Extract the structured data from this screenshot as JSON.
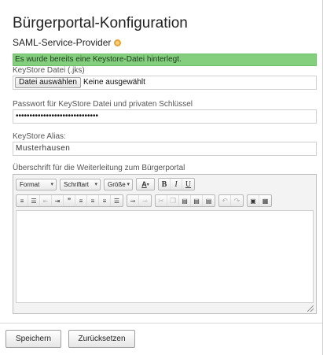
{
  "heading": "Bürgerportal-Konfiguration",
  "section": {
    "title": "SAML-Service-Provider",
    "icon": "info-icon"
  },
  "notice": "Es wurde bereits eine Keystore-Datei hinterlegt.",
  "keystore_file": {
    "label": "KeyStore Datei (.jks)",
    "button_label": "Datei auswählen",
    "status": "Keine ausgewählt"
  },
  "password": {
    "label": "Passwort für KeyStore Datei und privaten Schlüssel",
    "value": "••••••••••••••••••••••••••••••"
  },
  "alias": {
    "label": "KeyStore Alias:",
    "value": "Musterhausen"
  },
  "editor": {
    "label": "Überschrift für die Weiterleitung zum Bürgerportal",
    "combos": {
      "format": "Format",
      "font": "Schriftart",
      "size": "Größe"
    },
    "text_color_label": "A",
    "bold": "B",
    "italic": "I",
    "underline": "U",
    "list_numbered": "⒈",
    "list_bullet": "•",
    "blockquote": "❞"
  },
  "buttons": {
    "save": "Speichern",
    "reset": "Zurücksetzen"
  },
  "colors": {
    "notice_bg": "#84cf7e",
    "info_icon": "#e7a13a"
  }
}
